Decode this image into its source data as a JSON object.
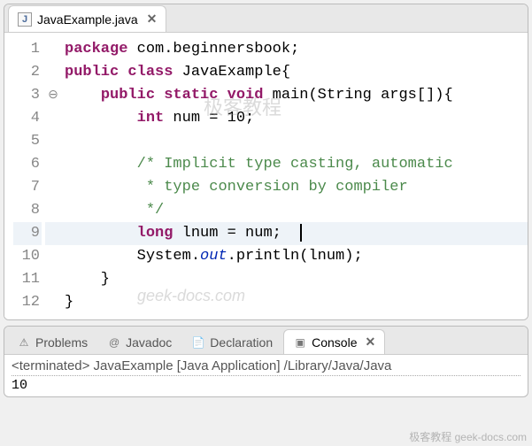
{
  "editor": {
    "tab": {
      "filename": "JavaExample.java",
      "icon_letter": "J"
    },
    "fold_marker_line": 3,
    "highlighted_line": 9,
    "lines": [
      {
        "n": 1,
        "tokens": [
          [
            "kw",
            "package"
          ],
          [
            "",
            " com.beginnersbook;"
          ]
        ]
      },
      {
        "n": 2,
        "tokens": [
          [
            "kw",
            "public class"
          ],
          [
            "",
            " JavaExample{"
          ]
        ]
      },
      {
        "n": 3,
        "tokens": [
          [
            "",
            "    "
          ],
          [
            "kw",
            "public static void"
          ],
          [
            "",
            " main(String args[]){"
          ]
        ]
      },
      {
        "n": 4,
        "tokens": [
          [
            "",
            "        "
          ],
          [
            "kw",
            "int"
          ],
          [
            "",
            " num = 10;"
          ]
        ]
      },
      {
        "n": 5,
        "tokens": [
          [
            "",
            ""
          ]
        ]
      },
      {
        "n": 6,
        "tokens": [
          [
            "",
            "        "
          ],
          [
            "cm",
            "/* Implicit type casting, automatic"
          ]
        ]
      },
      {
        "n": 7,
        "tokens": [
          [
            "",
            "         "
          ],
          [
            "cm",
            "* type conversion by compiler"
          ]
        ]
      },
      {
        "n": 8,
        "tokens": [
          [
            "",
            "         "
          ],
          [
            "cm",
            "*/"
          ]
        ]
      },
      {
        "n": 9,
        "tokens": [
          [
            "",
            "        "
          ],
          [
            "kw",
            "long"
          ],
          [
            "",
            " lnum = num;"
          ]
        ],
        "caret_after": true
      },
      {
        "n": 10,
        "tokens": [
          [
            "",
            "        System."
          ],
          [
            "fld",
            "out"
          ],
          [
            "",
            ".println(lnum);"
          ]
        ]
      },
      {
        "n": 11,
        "tokens": [
          [
            "",
            "    }"
          ]
        ]
      },
      {
        "n": 12,
        "tokens": [
          [
            "",
            "}"
          ]
        ]
      }
    ]
  },
  "bottom": {
    "tabs": [
      {
        "id": "problems",
        "label": "Problems",
        "icon": "⚠"
      },
      {
        "id": "javadoc",
        "label": "Javadoc",
        "icon": "@"
      },
      {
        "id": "declaration",
        "label": "Declaration",
        "icon": "📄"
      },
      {
        "id": "console",
        "label": "Console",
        "icon": "▣",
        "active": true
      }
    ],
    "console": {
      "status": "<terminated> JavaExample [Java Application] /Library/Java/Java",
      "output": "10"
    }
  },
  "watermarks": {
    "w1": "极客教程",
    "w2": "geek-docs.com",
    "w3": "极客教程 geek-docs.com"
  }
}
